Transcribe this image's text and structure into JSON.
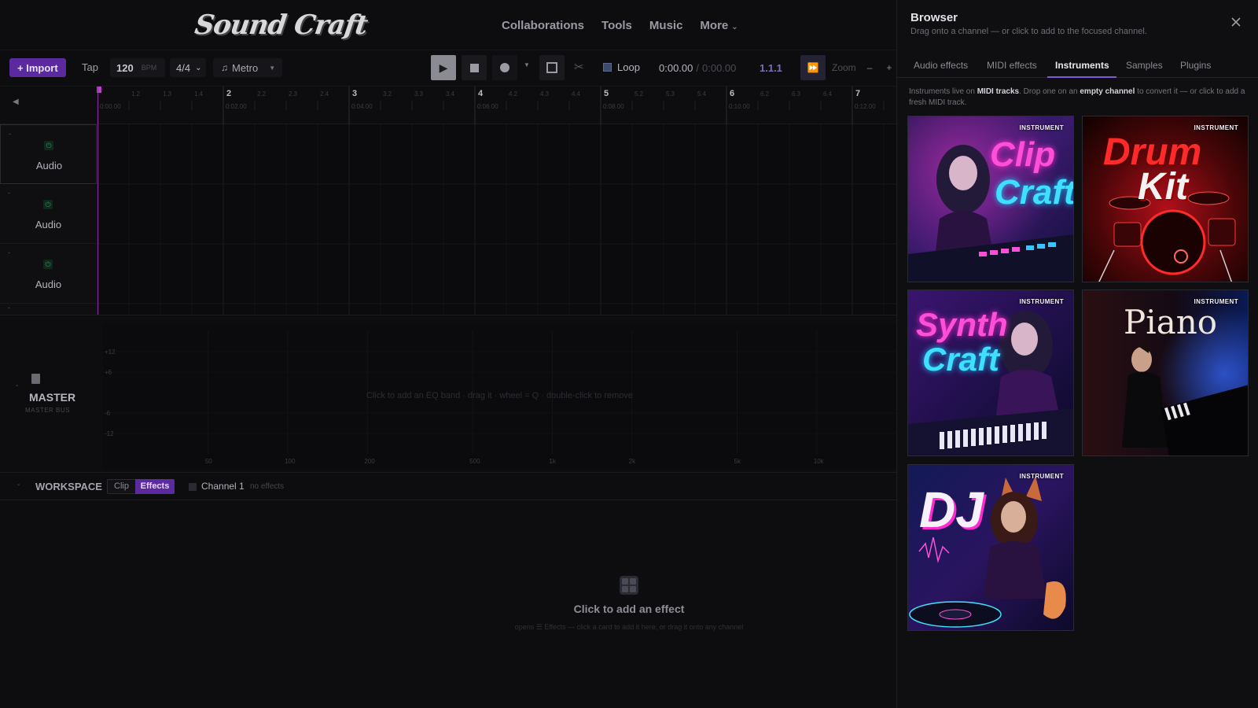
{
  "app": {
    "logo": "Sound Craft"
  },
  "nav": {
    "links": [
      "Collaborations",
      "Tools",
      "Music"
    ],
    "more": "More"
  },
  "toolbar": {
    "import": "+ Import",
    "tap": "Tap",
    "bpm": "120",
    "bpm_unit": "BPM",
    "time_signature": "4/4",
    "metronome": "Metro",
    "loop": "Loop",
    "time_current": "0:00.00",
    "time_separator": "/",
    "time_total": "0:00.00",
    "position": "1.1.1",
    "zoom": "Zoom",
    "zoom_minus": "–",
    "zoom_plus": "+"
  },
  "ruler": {
    "bars": [
      "2",
      "3",
      "4",
      "5",
      "6",
      "7"
    ],
    "beats": [
      "1.2",
      "1.3",
      "1.4",
      "2.2",
      "2.3",
      "2.4",
      "3.2",
      "3.3",
      "3.4",
      "4.2",
      "4.3",
      "4.4",
      "5.2",
      "5.3",
      "5.4",
      "6.2",
      "6.3",
      "6.4"
    ],
    "times": [
      "0:00.00",
      "0:02.00",
      "0:04.00",
      "0:06.00",
      "0:08.00",
      "0:10.00",
      "0:12.00"
    ]
  },
  "tracks": [
    {
      "label": "Audio"
    },
    {
      "label": "Audio"
    },
    {
      "label": "Audio"
    }
  ],
  "master": {
    "title": "MASTER",
    "subtitle": "MASTER BUS",
    "eq_hint": "Click to add an EQ band · drag it · wheel = Q · double-click to remove",
    "db_labels": [
      "+12",
      "+6",
      "-6",
      "-12"
    ],
    "freq_labels": [
      "50",
      "100",
      "200",
      "500",
      "1k",
      "2k",
      "5k",
      "10k"
    ]
  },
  "workspace": {
    "title": "WORKSPACE",
    "tab_clip": "Clip",
    "tab_effects": "Effects",
    "channel": "Channel 1",
    "channel_status": "no effects",
    "empty_title": "Click to add an effect",
    "empty_sub": "opens ☰ Effects — click a card to add it here, or drag it onto any channel"
  },
  "browser": {
    "title": "Browser",
    "subtitle": "Drag onto a channel — or click to add to the focused channel.",
    "tabs": [
      "Audio effects",
      "MIDI effects",
      "Instruments",
      "Samples",
      "Plugins"
    ],
    "active_tab": "Instruments",
    "note_parts": [
      "Instruments live on ",
      "MIDI tracks",
      ". Drop one on an ",
      "empty channel",
      " to convert it — or click to add a fresh MIDI track."
    ],
    "badge": "INSTRUMENT",
    "cards": [
      {
        "name": "Clip Craft",
        "line1": "Clip",
        "line2": "Craft"
      },
      {
        "name": "Drum Kit",
        "line1": "Drum",
        "line2": "Kit"
      },
      {
        "name": "Synth Craft",
        "line1": "Synth",
        "line2": "Craft"
      },
      {
        "name": "Piano",
        "line1": "Piano",
        "line2": ""
      },
      {
        "name": "DJ",
        "line1": "DJ",
        "line2": ""
      }
    ]
  },
  "colors": {
    "accent": "#5b2a9e",
    "playhead": "#c23cd6",
    "eq_line_left": "#2a9aa8",
    "eq_line_right": "#b23a9a"
  }
}
